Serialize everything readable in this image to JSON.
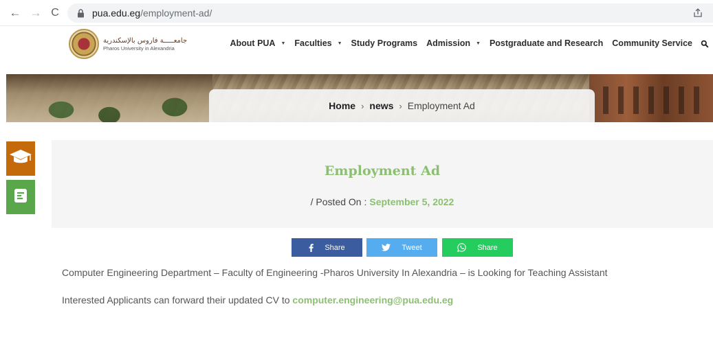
{
  "browser": {
    "url_host": "pua.edu.eg",
    "url_path": "/employment-ad/",
    "back_glyph": "←",
    "forward_glyph": "→",
    "reload_glyph": "C"
  },
  "logo": {
    "arabic": "جامعـــــة فاروس بالإسكندرية",
    "english": "Pharos University in Alexandria"
  },
  "nav": {
    "items": [
      {
        "label": "About PUA",
        "has_caret": true
      },
      {
        "label": "Faculties",
        "has_caret": true
      },
      {
        "label": "Study Programs",
        "has_caret": false
      },
      {
        "label": "Admission",
        "has_caret": true
      },
      {
        "label": "Postgraduate and Research",
        "has_caret": false
      },
      {
        "label": "Community Service",
        "has_caret": false
      }
    ],
    "caret": "▼"
  },
  "breadcrumb": {
    "home": "Home",
    "news": "news",
    "current": "Employment Ad",
    "separator": "›"
  },
  "post": {
    "title": "Employment Ad",
    "posted_label": "/ Posted On :",
    "posted_date": "September 5, 2022"
  },
  "share": {
    "facebook": "Share",
    "twitter": "Tweet",
    "whatsapp": "Share"
  },
  "content": {
    "line1": "Computer Engineering Department – Faculty of Engineering -Pharos University In Alexandria – is Looking for Teaching Assistant",
    "line2_prefix": "Interested Applicants can forward their updated CV  to ",
    "email": "computer.engineering@pua.edu.eg"
  },
  "colors": {
    "accent_green": "#8cbf72",
    "side_orange": "#c46a0a",
    "side_green": "#5aa64a",
    "facebook": "#3b5c9e",
    "twitter": "#55acee",
    "whatsapp": "#25cc5e"
  },
  "icons": {
    "side_top": "graduation-cap-icon",
    "side_bottom": "news-document-icon",
    "search": "search-icon",
    "lock": "lock-icon",
    "share_page": "share-page-icon"
  }
}
